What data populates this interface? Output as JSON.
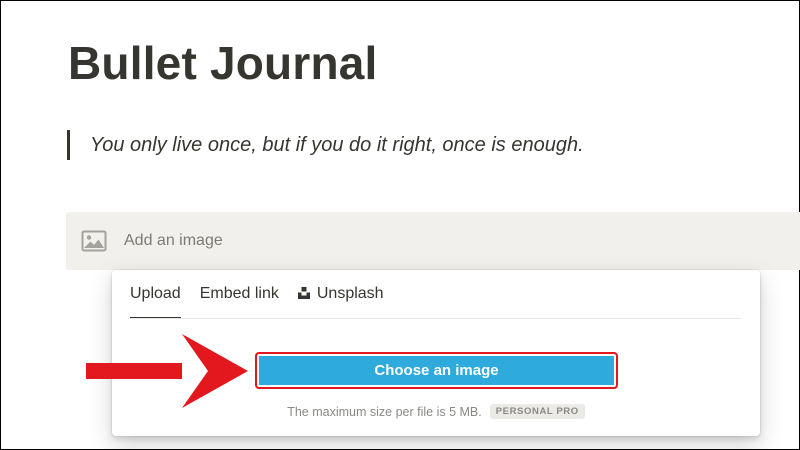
{
  "page": {
    "title": "Bullet Journal",
    "quote": "You only live once, but if you do it right, once is enough."
  },
  "image_block": {
    "icon": "image-icon",
    "label": "Add an image"
  },
  "popover": {
    "tabs": [
      {
        "label": "Upload",
        "active": true
      },
      {
        "label": "Embed link",
        "active": false
      },
      {
        "label": "Unsplash",
        "active": false,
        "icon": "unsplash-icon"
      }
    ],
    "choose_button": "Choose an image",
    "size_note": "The maximum size per file is 5 MB.",
    "plan_badge": "PERSONAL PRO"
  },
  "annotation": {
    "arrow_color": "#e3171e",
    "highlight_color": "#e3171e"
  },
  "colors": {
    "text": "#37352f",
    "button": "#2eaadc",
    "placeholder_bg": "#f1f0ec"
  }
}
